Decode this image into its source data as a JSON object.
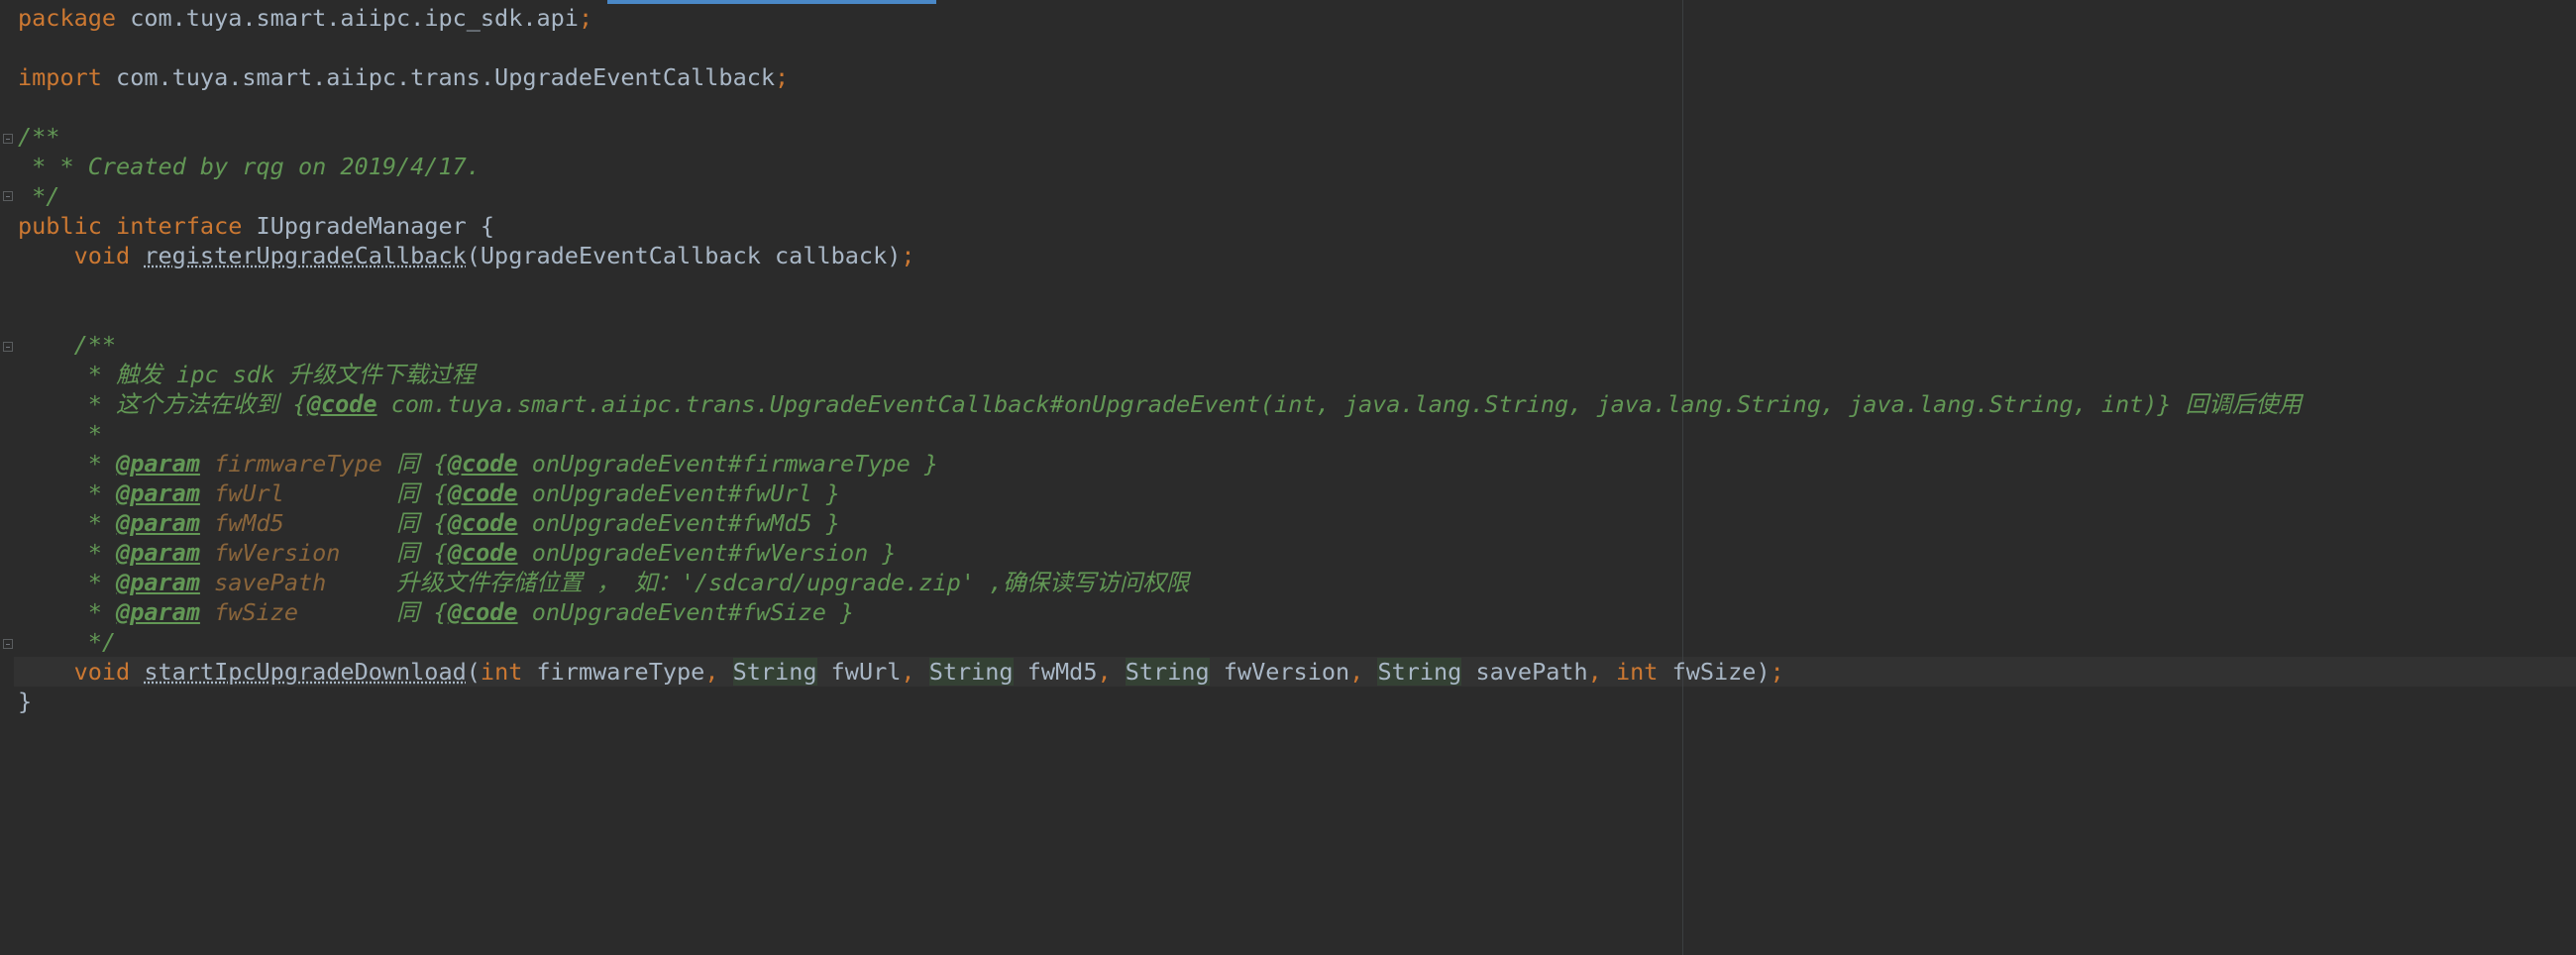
{
  "code": {
    "package_kw": "package",
    "package_name": "com.tuya.smart.aiipc.ipc_sdk.api",
    "import_kw": "import",
    "import_name": "com.tuya.smart.aiipc.trans.UpgradeEventCallback",
    "semicolon": ";",
    "comment1_open": "/**",
    "comment1_body": " * * Created by rqg on 2019/4/17.",
    "comment1_close": " */",
    "public_kw": "public",
    "interface_kw": "interface",
    "interface_name": "IUpgradeManager {",
    "void_kw": "void",
    "method1_name": "registerUpgradeCallback",
    "method1_params": "(UpgradeEventCallback callback)",
    "doc_open": "/**",
    "doc_line1": " * 触发 ipc sdk 升级文件下载过程",
    "doc_line2_prefix": " * 这个方法在收到 {",
    "code_tag": "@code",
    "doc_line2_rest": " com.tuya.smart.aiipc.trans.UpgradeEventCallback#onUpgradeEvent(int, java.lang.String, java.lang.String, java.lang.String, int)} 回调后使用",
    "doc_empty": " *",
    "doc_star": " * ",
    "param_tag": "@param",
    "params": [
      {
        "name": " firmwareType",
        "pad": " ",
        "desc": "同 {",
        "code": "@code",
        "ref": " onUpgradeEvent#firmwareType }"
      },
      {
        "name": " fwUrl",
        "pad": "        ",
        "desc": "同 {",
        "code": "@code",
        "ref": " onUpgradeEvent#fwUrl }"
      },
      {
        "name": " fwMd5",
        "pad": "        ",
        "desc": "同 {",
        "code": "@code",
        "ref": " onUpgradeEvent#fwMd5 }"
      },
      {
        "name": " fwVersion",
        "pad": "    ",
        "desc": "同 {",
        "code": "@code",
        "ref": " onUpgradeEvent#fwVersion }"
      }
    ],
    "param_savepath_name": " savePath",
    "param_savepath_desc": "     升级文件存储位置 ， 如：'/sdcard/upgrade.zip' ,确保读写访问权限",
    "param_fwsize_name": " fwSize",
    "param_fwsize_pad": "       ",
    "param_fwsize_desc": "同 {",
    "param_fwsize_ref": " onUpgradeEvent#fwSize }",
    "doc_close": " */",
    "method2_name": "startIpcUpgradeDownload",
    "int_kw": "int",
    "string_type": "String",
    "arg_firmwareType": " firmwareType",
    "arg_fwUrl": " fwUrl",
    "arg_fwMd5": " fwMd5",
    "arg_fwVersion": " fwVersion",
    "arg_savePath": " savePath",
    "arg_fwSize": " fwSize",
    "comma": ", ",
    "close_brace": "}"
  }
}
